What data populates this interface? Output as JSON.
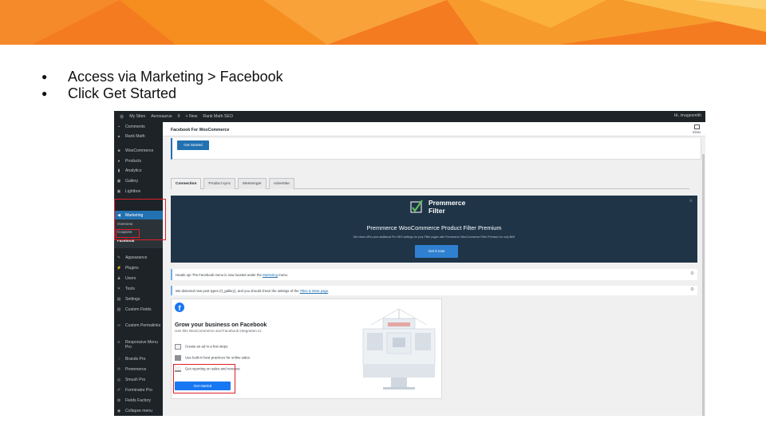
{
  "colors": {
    "banner_primary": "#f47b20",
    "banner_light": "#fbb03b",
    "wp_sidebar": "#1d2327",
    "wp_blue": "#2271b1",
    "highlight_red": "#e0202a",
    "promo_bg": "#1f3447",
    "facebook_blue": "#1877f2"
  },
  "bullets": [
    "Access via Marketing > Facebook",
    "Click Get Started"
  ],
  "admin_bar": {
    "items": [
      "My Sites",
      "Aerosaurus",
      "0",
      "+ New",
      "Rank Math SEO"
    ],
    "greeting": "Hi, imagesmith"
  },
  "sidebar": {
    "items": [
      {
        "label": "Comments",
        "icon": "comment-icon"
      },
      {
        "label": "Rank Math",
        "icon": "chart-icon"
      },
      {
        "label": "WooCommerce",
        "icon": "woo-icon"
      },
      {
        "label": "Products",
        "icon": "box-icon"
      },
      {
        "label": "Analytics",
        "icon": "bar-chart-icon"
      },
      {
        "label": "Gallery",
        "icon": "gallery-icon"
      },
      {
        "label": "Lightbox",
        "icon": "lightbox-icon"
      },
      {
        "label": "Marketing",
        "icon": "megaphone-icon"
      },
      {
        "label": "Appearance",
        "icon": "brush-icon"
      },
      {
        "label": "Plugins",
        "icon": "plug-icon"
      },
      {
        "label": "Users",
        "icon": "user-icon"
      },
      {
        "label": "Tools",
        "icon": "wrench-icon"
      },
      {
        "label": "Settings",
        "icon": "settings-icon"
      },
      {
        "label": "Custom Fields",
        "icon": "fields-icon"
      },
      {
        "label": "Custom Permalinks",
        "icon": "link-icon"
      },
      {
        "label": "Responsive Menu Pro",
        "icon": "menu-icon"
      },
      {
        "label": "Brands Pro",
        "icon": "tag-icon"
      },
      {
        "label": "Premmerce",
        "icon": "p-icon"
      },
      {
        "label": "Smush Pro",
        "icon": "smush-icon"
      },
      {
        "label": "Forminator Pro",
        "icon": "form-icon"
      },
      {
        "label": "Fields Factory",
        "icon": "factory-icon"
      },
      {
        "label": "Collapse menu",
        "icon": "collapse-icon"
      }
    ],
    "submenu": [
      "Overview",
      "Coupons",
      "Facebook"
    ]
  },
  "page": {
    "title": "Facebook For WooCommerce",
    "inbox_label": "Inbox",
    "top_button": "Get Started",
    "tabs": [
      "Connection",
      "Product sync",
      "Messenger",
      "Advertise"
    ]
  },
  "promo": {
    "logo_line1": "Premmerce",
    "logo_line2": "Filter",
    "headline": "Premmerce WooCommerce Product Filter Premium",
    "subtext": "Get clean URLs and additional Pro SEO settings for your Filter pages with Premmerce WooCommerce Filter Premium for only $69!",
    "button": "Get it now"
  },
  "notices": [
    {
      "text": "Heads up! The Facebook menu is now located under the",
      "link": "Marketing",
      "suffix": "menu."
    },
    {
      "text": "We detected new post types (rl_gallery), and you should check the settings of the",
      "link": "Titles & Meta page",
      "suffix": "."
    }
  ],
  "facebook": {
    "title": "Grow your business on Facebook",
    "subtitle": "Use this WooCommerce and Facebook integration to:",
    "features": [
      "Create an ad in a few steps",
      "Use built-in best practices for online sales",
      "Get reporting on sales and revenue"
    ],
    "button": "Get started"
  }
}
